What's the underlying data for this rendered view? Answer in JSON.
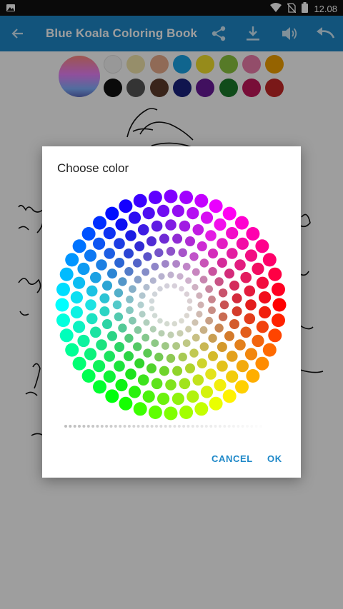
{
  "status_bar": {
    "time": "12.08",
    "icons": [
      "image-icon",
      "wifi-icon",
      "no-sim-icon",
      "battery-icon"
    ]
  },
  "app_bar": {
    "title": "Blue Koala Coloring Book",
    "actions": [
      "back-arrow-icon",
      "share-icon",
      "download-icon",
      "volume-icon",
      "undo-icon"
    ],
    "color": "#1e88c8"
  },
  "palette": {
    "selected_swatch": "gradient-swatch",
    "colors_top": [
      "#f5f5f5",
      "#f3e5ab",
      "#e8ab8c",
      "#1aa3e6",
      "#f2e02c",
      "#8cc540",
      "#ee7dab",
      "#f0a000"
    ],
    "colors_bottom": [
      "#111111",
      "#555555",
      "#5d3a2a",
      "#1a237e",
      "#6a1b9a",
      "#1b7a2b",
      "#c2185b",
      "#c62828"
    ]
  },
  "dialog": {
    "title": "Choose color",
    "cancel_label": "CANCEL",
    "ok_label": "OK"
  }
}
